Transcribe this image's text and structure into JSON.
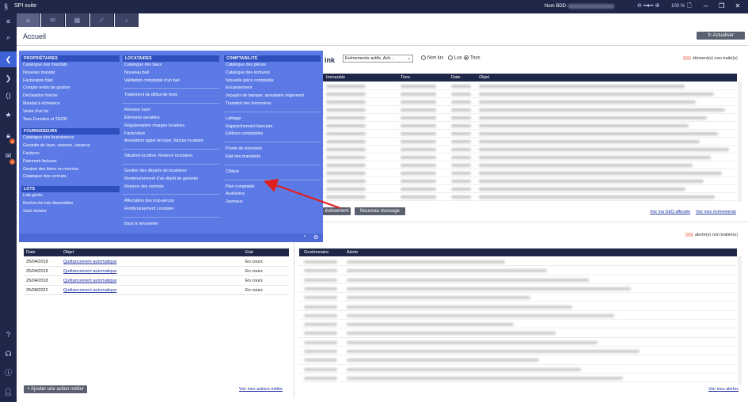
{
  "window": {
    "title": "SPI suite",
    "nom_label": "Nom BDD :",
    "zoom": "100 %"
  },
  "page": {
    "title": "Accueil",
    "refresh_label": "Actualiser"
  },
  "flyout": {
    "proprietaires": {
      "header": "PROPRIÉTAIRES",
      "items": [
        "Catalogue des mandats",
        "Nouveau mandat",
        "Facturation frais",
        "Compte rendu de gestion",
        "Déclaration foncier",
        "Mandat à échéance",
        "Vente d'un lot",
        "Taxe Foncière et TEOM"
      ]
    },
    "fournisseurs": {
      "header": "FOURNISSEURS",
      "items": [
        "Catalogue des fournisseurs",
        "Garantie de loyer, carence, vacance",
        "Factures",
        "Paiement factures",
        "Gestion des biens en nourrice",
        "Catalogue des contrats"
      ]
    },
    "lots": {
      "header": "LOTS",
      "items": [
        "Lots gérés",
        "Recherche lots disponibles",
        "Suivi dossier"
      ]
    },
    "locataires": {
      "header": "LOCATAIRES",
      "group1": [
        "Catalogue des baux",
        "Nouveau bail",
        "Validation comptable d'un bail"
      ],
      "group2": [
        "Traitement de début de mois"
      ],
      "group3": [
        "Révision loyer",
        "Éléments variables",
        "Régularisation charges locatives",
        "Facturation",
        "Annulation appel de loyer, facture locataire"
      ],
      "group4": [
        "Situation locative, Relance locataires"
      ],
      "group5": [
        "Gestion des départs de locataires",
        "Remboursement d'un dépôt de garantie",
        "Relance des contrats"
      ],
      "group6": [
        "Affectation des trop-perçus",
        "Remboursement Locataire"
      ],
      "group7": [
        "Baux à renouveler"
      ]
    },
    "comptabilite": {
      "header": "COMPTABILITÉ",
      "group1": [
        "Catalogue des pièces",
        "Catalogue des écritures",
        "Nouvelle pièce comptable",
        "Encaissement",
        "Impayés de banque, annulation règlement",
        "Transfert des honoraires"
      ],
      "group2": [
        "Lettrage",
        "Rapprochement bancaire",
        "Editions comptables"
      ],
      "group3": [
        "Pointe de trésorerie",
        "Etat des mandants"
      ],
      "group4": [
        "Clôture"
      ],
      "group5": [
        "Plan comptable",
        "Auxiliaires",
        "Journaux"
      ]
    }
  },
  "events": {
    "title_fragment": "ink",
    "filter_value": "Evènements actifs, Acti...",
    "radios": [
      {
        "label": "Non lus",
        "checked": false
      },
      {
        "label": "Lus",
        "checked": false
      },
      {
        "label": "Tous",
        "checked": true
      }
    ],
    "counter": "élément(s) non traité(s)",
    "columns": [
      "Immeuble",
      "Tiers",
      "Date",
      "Objet"
    ],
    "btn_event": "évènement",
    "btn_new_message": "Nouveau message",
    "link_ged": "Voir ma GED affectée",
    "link_events": "Voir mes évènements"
  },
  "alerts": {
    "counter": "alerte(s) non traitée(s)",
    "columns": [
      "Gestionnaire",
      "Alerte"
    ],
    "link_all": "Voir mes alertes"
  },
  "actions": {
    "columns": [
      "Date",
      "Objet",
      "Etat"
    ],
    "rows": [
      {
        "date": "25/04/2018",
        "objet": "Quittancement automatique",
        "etat": "En cours"
      },
      {
        "date": "25/04/2018",
        "objet": "Quittancement automatique",
        "etat": "En cours"
      },
      {
        "date": "25/04/2018",
        "objet": "Quittancement automatique",
        "etat": "En cours"
      },
      {
        "date": "25/08/2022",
        "objet": "Quittancement automatique",
        "etat": "En cours"
      }
    ],
    "add_button": "+ Ajouter une action métier",
    "link_all": "Voir mes actions métier"
  },
  "colors": {
    "nav": "#1f2749",
    "flyout": "#5b7ae6",
    "flyout_header": "#2f4fbf",
    "arrow": "#e02020",
    "accent": "#3e63d6"
  }
}
